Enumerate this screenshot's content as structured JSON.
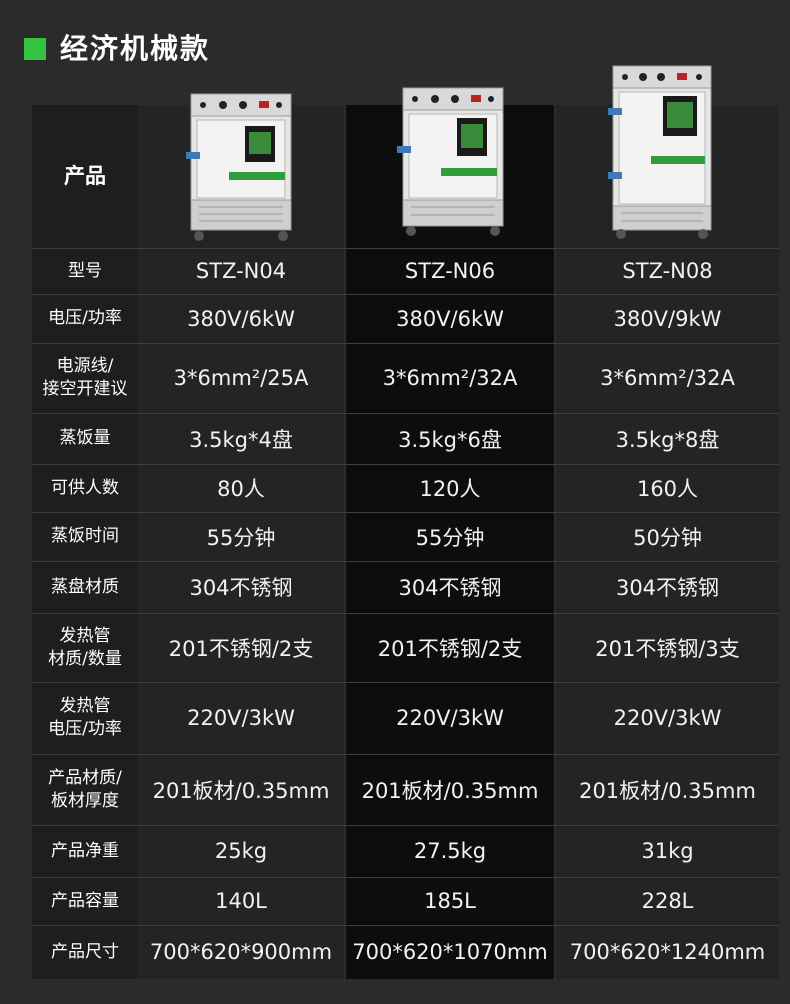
{
  "header": {
    "title": "经济机械款"
  },
  "table": {
    "product_label": "产品",
    "products": [
      {
        "image": "steamer-cabinet-image",
        "model": "STZ-N04"
      },
      {
        "image": "steamer-cabinet-image",
        "model": "STZ-N06"
      },
      {
        "image": "steamer-cabinet-image",
        "model": "STZ-N08"
      }
    ],
    "rows": [
      {
        "label": "型号",
        "values": [
          "STZ-N04",
          "STZ-N06",
          "STZ-N08"
        ]
      },
      {
        "label": "电压/功率",
        "values": [
          "380V/6kW",
          "380V/6kW",
          "380V/9kW"
        ]
      },
      {
        "label": "电源线/\n接空开建议",
        "values": [
          "3*6mm²/25A",
          "3*6mm²/32A",
          "3*6mm²/32A"
        ]
      },
      {
        "label": "蒸饭量",
        "values": [
          "3.5kg*4盘",
          "3.5kg*6盘",
          "3.5kg*8盘"
        ]
      },
      {
        "label": "可供人数",
        "values": [
          "80人",
          "120人",
          "160人"
        ]
      },
      {
        "label": "蒸饭时间",
        "values": [
          "55分钟",
          "55分钟",
          "50分钟"
        ]
      },
      {
        "label": "蒸盘材质",
        "values": [
          "304不锈钢",
          "304不锈钢",
          "304不锈钢"
        ]
      },
      {
        "label": "发热管\n材质/数量",
        "values": [
          "201不锈钢/2支",
          "201不锈钢/2支",
          "201不锈钢/3支"
        ]
      },
      {
        "label": "发热管\n电压/功率",
        "values": [
          "220V/3kW",
          "220V/3kW",
          "220V/3kW"
        ]
      },
      {
        "label": "产品材质/\n板材厚度",
        "values": [
          "201板材/0.35mm",
          "201板材/0.35mm",
          "201板材/0.35mm"
        ]
      },
      {
        "label": "产品净重",
        "values": [
          "25kg",
          "27.5kg",
          "31kg"
        ]
      },
      {
        "label": "产品容量",
        "values": [
          "140L",
          "185L",
          "228L"
        ]
      },
      {
        "label": "产品尺寸",
        "values": [
          "700*620*900mm",
          "700*620*1070mm",
          "700*620*1240mm"
        ]
      }
    ]
  },
  "colors": {
    "accent": "#34c241",
    "background": "#2b2b2b",
    "column_dark": "#0d0d0d",
    "column_mid": "#242424",
    "label_column": "#1e1e1e"
  }
}
